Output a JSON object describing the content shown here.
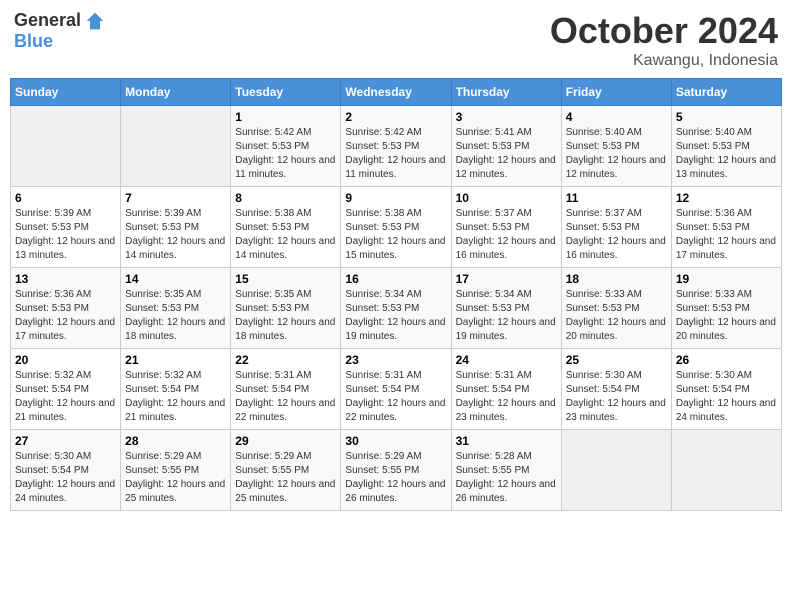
{
  "header": {
    "logo_general": "General",
    "logo_blue": "Blue",
    "month_title": "October 2024",
    "location": "Kawangu, Indonesia"
  },
  "weekdays": [
    "Sunday",
    "Monday",
    "Tuesday",
    "Wednesday",
    "Thursday",
    "Friday",
    "Saturday"
  ],
  "weeks": [
    [
      {
        "day": "",
        "sunrise": "",
        "sunset": "",
        "daylight": "",
        "empty": true
      },
      {
        "day": "",
        "sunrise": "",
        "sunset": "",
        "daylight": "",
        "empty": true
      },
      {
        "day": "1",
        "sunrise": "Sunrise: 5:42 AM",
        "sunset": "Sunset: 5:53 PM",
        "daylight": "Daylight: 12 hours and 11 minutes."
      },
      {
        "day": "2",
        "sunrise": "Sunrise: 5:42 AM",
        "sunset": "Sunset: 5:53 PM",
        "daylight": "Daylight: 12 hours and 11 minutes."
      },
      {
        "day": "3",
        "sunrise": "Sunrise: 5:41 AM",
        "sunset": "Sunset: 5:53 PM",
        "daylight": "Daylight: 12 hours and 12 minutes."
      },
      {
        "day": "4",
        "sunrise": "Sunrise: 5:40 AM",
        "sunset": "Sunset: 5:53 PM",
        "daylight": "Daylight: 12 hours and 12 minutes."
      },
      {
        "day": "5",
        "sunrise": "Sunrise: 5:40 AM",
        "sunset": "Sunset: 5:53 PM",
        "daylight": "Daylight: 12 hours and 13 minutes."
      }
    ],
    [
      {
        "day": "6",
        "sunrise": "Sunrise: 5:39 AM",
        "sunset": "Sunset: 5:53 PM",
        "daylight": "Daylight: 12 hours and 13 minutes."
      },
      {
        "day": "7",
        "sunrise": "Sunrise: 5:39 AM",
        "sunset": "Sunset: 5:53 PM",
        "daylight": "Daylight: 12 hours and 14 minutes."
      },
      {
        "day": "8",
        "sunrise": "Sunrise: 5:38 AM",
        "sunset": "Sunset: 5:53 PM",
        "daylight": "Daylight: 12 hours and 14 minutes."
      },
      {
        "day": "9",
        "sunrise": "Sunrise: 5:38 AM",
        "sunset": "Sunset: 5:53 PM",
        "daylight": "Daylight: 12 hours and 15 minutes."
      },
      {
        "day": "10",
        "sunrise": "Sunrise: 5:37 AM",
        "sunset": "Sunset: 5:53 PM",
        "daylight": "Daylight: 12 hours and 16 minutes."
      },
      {
        "day": "11",
        "sunrise": "Sunrise: 5:37 AM",
        "sunset": "Sunset: 5:53 PM",
        "daylight": "Daylight: 12 hours and 16 minutes."
      },
      {
        "day": "12",
        "sunrise": "Sunrise: 5:36 AM",
        "sunset": "Sunset: 5:53 PM",
        "daylight": "Daylight: 12 hours and 17 minutes."
      }
    ],
    [
      {
        "day": "13",
        "sunrise": "Sunrise: 5:36 AM",
        "sunset": "Sunset: 5:53 PM",
        "daylight": "Daylight: 12 hours and 17 minutes."
      },
      {
        "day": "14",
        "sunrise": "Sunrise: 5:35 AM",
        "sunset": "Sunset: 5:53 PM",
        "daylight": "Daylight: 12 hours and 18 minutes."
      },
      {
        "day": "15",
        "sunrise": "Sunrise: 5:35 AM",
        "sunset": "Sunset: 5:53 PM",
        "daylight": "Daylight: 12 hours and 18 minutes."
      },
      {
        "day": "16",
        "sunrise": "Sunrise: 5:34 AM",
        "sunset": "Sunset: 5:53 PM",
        "daylight": "Daylight: 12 hours and 19 minutes."
      },
      {
        "day": "17",
        "sunrise": "Sunrise: 5:34 AM",
        "sunset": "Sunset: 5:53 PM",
        "daylight": "Daylight: 12 hours and 19 minutes."
      },
      {
        "day": "18",
        "sunrise": "Sunrise: 5:33 AM",
        "sunset": "Sunset: 5:53 PM",
        "daylight": "Daylight: 12 hours and 20 minutes."
      },
      {
        "day": "19",
        "sunrise": "Sunrise: 5:33 AM",
        "sunset": "Sunset: 5:53 PM",
        "daylight": "Daylight: 12 hours and 20 minutes."
      }
    ],
    [
      {
        "day": "20",
        "sunrise": "Sunrise: 5:32 AM",
        "sunset": "Sunset: 5:54 PM",
        "daylight": "Daylight: 12 hours and 21 minutes."
      },
      {
        "day": "21",
        "sunrise": "Sunrise: 5:32 AM",
        "sunset": "Sunset: 5:54 PM",
        "daylight": "Daylight: 12 hours and 21 minutes."
      },
      {
        "day": "22",
        "sunrise": "Sunrise: 5:31 AM",
        "sunset": "Sunset: 5:54 PM",
        "daylight": "Daylight: 12 hours and 22 minutes."
      },
      {
        "day": "23",
        "sunrise": "Sunrise: 5:31 AM",
        "sunset": "Sunset: 5:54 PM",
        "daylight": "Daylight: 12 hours and 22 minutes."
      },
      {
        "day": "24",
        "sunrise": "Sunrise: 5:31 AM",
        "sunset": "Sunset: 5:54 PM",
        "daylight": "Daylight: 12 hours and 23 minutes."
      },
      {
        "day": "25",
        "sunrise": "Sunrise: 5:30 AM",
        "sunset": "Sunset: 5:54 PM",
        "daylight": "Daylight: 12 hours and 23 minutes."
      },
      {
        "day": "26",
        "sunrise": "Sunrise: 5:30 AM",
        "sunset": "Sunset: 5:54 PM",
        "daylight": "Daylight: 12 hours and 24 minutes."
      }
    ],
    [
      {
        "day": "27",
        "sunrise": "Sunrise: 5:30 AM",
        "sunset": "Sunset: 5:54 PM",
        "daylight": "Daylight: 12 hours and 24 minutes."
      },
      {
        "day": "28",
        "sunrise": "Sunrise: 5:29 AM",
        "sunset": "Sunset: 5:55 PM",
        "daylight": "Daylight: 12 hours and 25 minutes."
      },
      {
        "day": "29",
        "sunrise": "Sunrise: 5:29 AM",
        "sunset": "Sunset: 5:55 PM",
        "daylight": "Daylight: 12 hours and 25 minutes."
      },
      {
        "day": "30",
        "sunrise": "Sunrise: 5:29 AM",
        "sunset": "Sunset: 5:55 PM",
        "daylight": "Daylight: 12 hours and 26 minutes."
      },
      {
        "day": "31",
        "sunrise": "Sunrise: 5:28 AM",
        "sunset": "Sunset: 5:55 PM",
        "daylight": "Daylight: 12 hours and 26 minutes."
      },
      {
        "day": "",
        "sunrise": "",
        "sunset": "",
        "daylight": "",
        "empty": true
      },
      {
        "day": "",
        "sunrise": "",
        "sunset": "",
        "daylight": "",
        "empty": true
      }
    ]
  ]
}
